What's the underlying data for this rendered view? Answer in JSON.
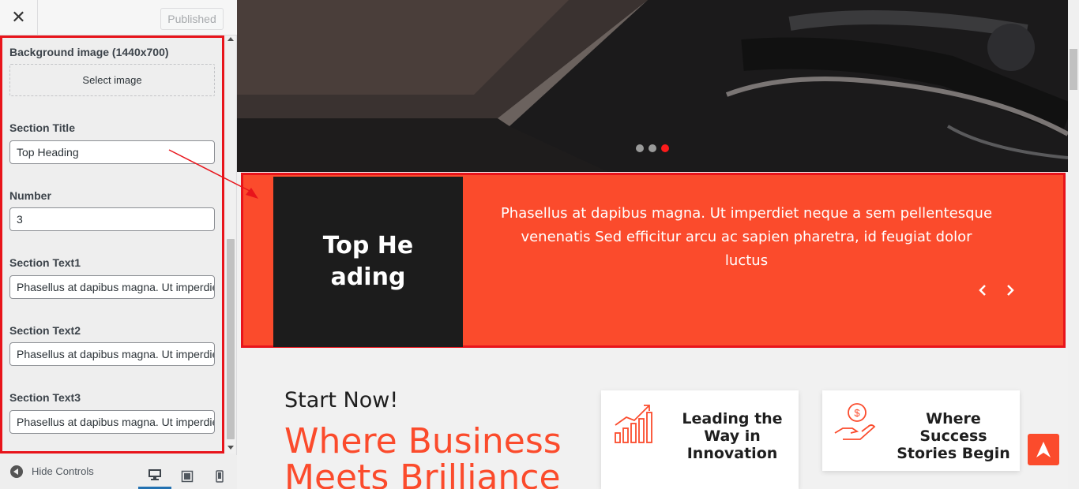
{
  "header": {
    "close_label": "✕",
    "publish_label": "Published"
  },
  "panel": {
    "bg_label": "Background image (1440x700)",
    "select_image_label": "Select image",
    "title_label": "Section Title",
    "title_value": "Top Heading",
    "number_label": "Number",
    "number_value": "3",
    "text1_label": "Section Text1",
    "text1_value": "Phasellus at dapibus magna. Ut imperdiet neque a sem pellentesque",
    "text2_label": "Section Text2",
    "text2_value": "Phasellus at dapibus magna. Ut imperdiet neque a sem pellentesque",
    "text3_label": "Section Text3",
    "text3_value": "Phasellus at dapibus magna. Ut imperdiet neque a sem pellentesque"
  },
  "footer": {
    "hide_label": "Hide Controls"
  },
  "preview": {
    "slider_dots": 3,
    "active_dot": 3,
    "heading": "Top Heading",
    "paragraph": "Phasellus at dapibus magna. Ut imperdiet neque a sem pellentesque venenatis Sed efficitur arcu ac sapien pharetra, id feugiat dolor luctus",
    "start_now": "Start Now!",
    "big_title": "Where Business Meets Brilliance",
    "cards": [
      {
        "title": "Leading the Way in Innovation",
        "icon": "growth-chart-icon"
      },
      {
        "title": "Where Success Stories Begin",
        "icon": "money-hand-icon"
      }
    ]
  },
  "colors": {
    "accent": "#fb4b2c",
    "highlight": "#e8141b",
    "dark": "#1c1c1c"
  }
}
